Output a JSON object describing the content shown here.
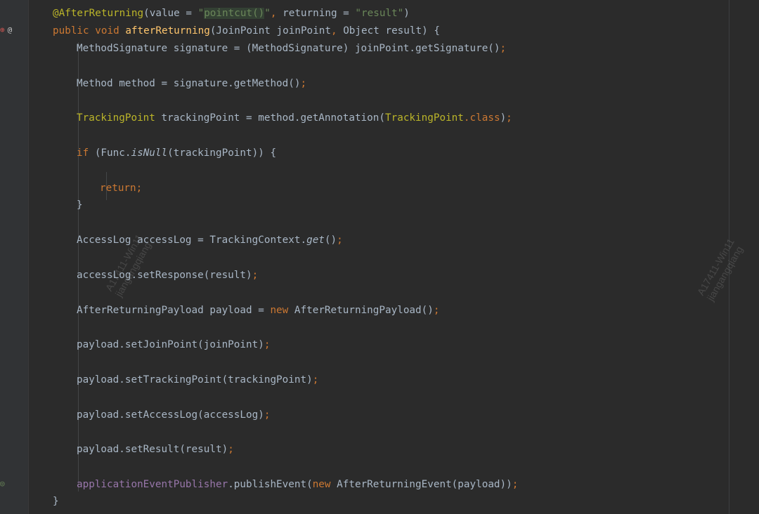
{
  "gutter": {
    "icons": [
      "bean-icon",
      "override-icon",
      "event-icon"
    ],
    "bean_glyph": "⊕",
    "override_glyph": "@",
    "event_glyph": "◎"
  },
  "code": {
    "l1": {
      "ann": "@AfterReturning",
      "p1": "(value = ",
      "s1": "\"",
      "s2": "pointcut()",
      "s3": "\"",
      "p2": ", ",
      "p3": "returning = ",
      "s4": "\"result\"",
      "p4": ")"
    },
    "l2": {
      "k1": "public ",
      "k2": "void ",
      "fn": "afterReturning",
      "p1": "(JoinPoint joinPoint",
      "c1": ", ",
      "p2": "Object result) {"
    },
    "l3": {
      "t": "MethodSignature signature = (MethodSignature) joinPoint.getSignature()",
      "semi": ";"
    },
    "l4": {
      "t": "Method method = signature.getMethod()",
      "semi": ";"
    },
    "l5": {
      "cls1": "TrackingPoint",
      "t1": " trackingPoint = method.getAnnotation(",
      "cls2": "TrackingPoint",
      "k": ".class",
      "t2": ")",
      "semi": ";"
    },
    "l6": {
      "k": "if ",
      "t1": "(Func.",
      "st": "isNull",
      "t2": "(trackingPoint)) {"
    },
    "l7": {
      "k": "return",
      "semi": ";"
    },
    "l8": {
      "t": "}"
    },
    "l9": {
      "t1": "AccessLog accessLog = TrackingContext.",
      "st": "get",
      "t2": "()",
      "semi": ";"
    },
    "l10": {
      "t": "accessLog.setResponse(result)",
      "semi": ";"
    },
    "l11": {
      "t1": "AfterReturningPayload payload = ",
      "k": "new ",
      "t2": "AfterReturningPayload()",
      "semi": ";"
    },
    "l12": {
      "t": "payload.setJoinPoint(joinPoint)",
      "semi": ";"
    },
    "l13": {
      "t": "payload.setTrackingPoint(trackingPoint)",
      "semi": ";"
    },
    "l14": {
      "t": "payload.setAccessLog(accessLog)",
      "semi": ";"
    },
    "l15": {
      "t": "payload.setResult(result)",
      "semi": ";"
    },
    "l16": {
      "f": "applicationEventPublisher",
      "t1": ".publishEvent(",
      "k": "new ",
      "t2": "AfterReturningEvent(payload))",
      "semi": ";"
    },
    "l17": {
      "t": "}"
    }
  },
  "watermarks": [
    {
      "text": "A17411-Win11\njiangangqiang"
    },
    {
      "text": "A17411-Win11\njiangangqiang"
    }
  ],
  "colors": {
    "background": "#2b2b2b",
    "keyword": "#cc7832",
    "method_decl": "#ffc66d",
    "annotation": "#bbb529",
    "string": "#6a8759",
    "field": "#9876aa",
    "default_text": "#a9b7c6"
  }
}
